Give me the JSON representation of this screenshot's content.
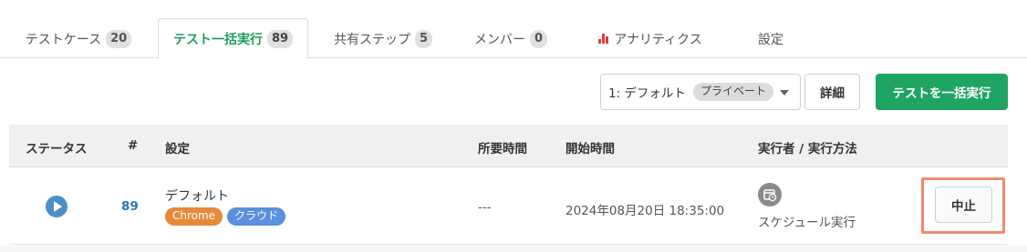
{
  "tabs": [
    {
      "label": "テストケース",
      "count": "20"
    },
    {
      "label": "テスト一括実行",
      "count": "89"
    },
    {
      "label": "共有ステップ",
      "count": "5"
    },
    {
      "label": "メンバー",
      "count": "0"
    },
    {
      "label": "アナリティクス",
      "icon": "bar-chart-icon"
    },
    {
      "label": "設定"
    }
  ],
  "active_tab": "テスト一括実行",
  "toolbar": {
    "config_select": {
      "value": "1: デフォルト",
      "badge": "プライベート"
    },
    "detail_label": "詳細",
    "run_all_label": "テストを一括実行"
  },
  "table": {
    "headers": [
      "ステータス",
      "#",
      "設定",
      "所要時間",
      "開始時間",
      "実行者 / 実行方法"
    ],
    "rows": [
      {
        "status": "play-icon",
        "number": "89",
        "config": "デフォルト",
        "tags": [
          "Chrome",
          "クラウド"
        ],
        "duration": "---",
        "started": "2024年08月20日 18:35:00",
        "executor": "スケジュール実行",
        "action": "中止"
      }
    ]
  },
  "colors": {
    "accent": "#1fa463",
    "link": "#2a72b5",
    "chrome_tag": "#e8893a",
    "cloud_tag": "#5b8fe0",
    "highlight": "#f08a6d"
  }
}
